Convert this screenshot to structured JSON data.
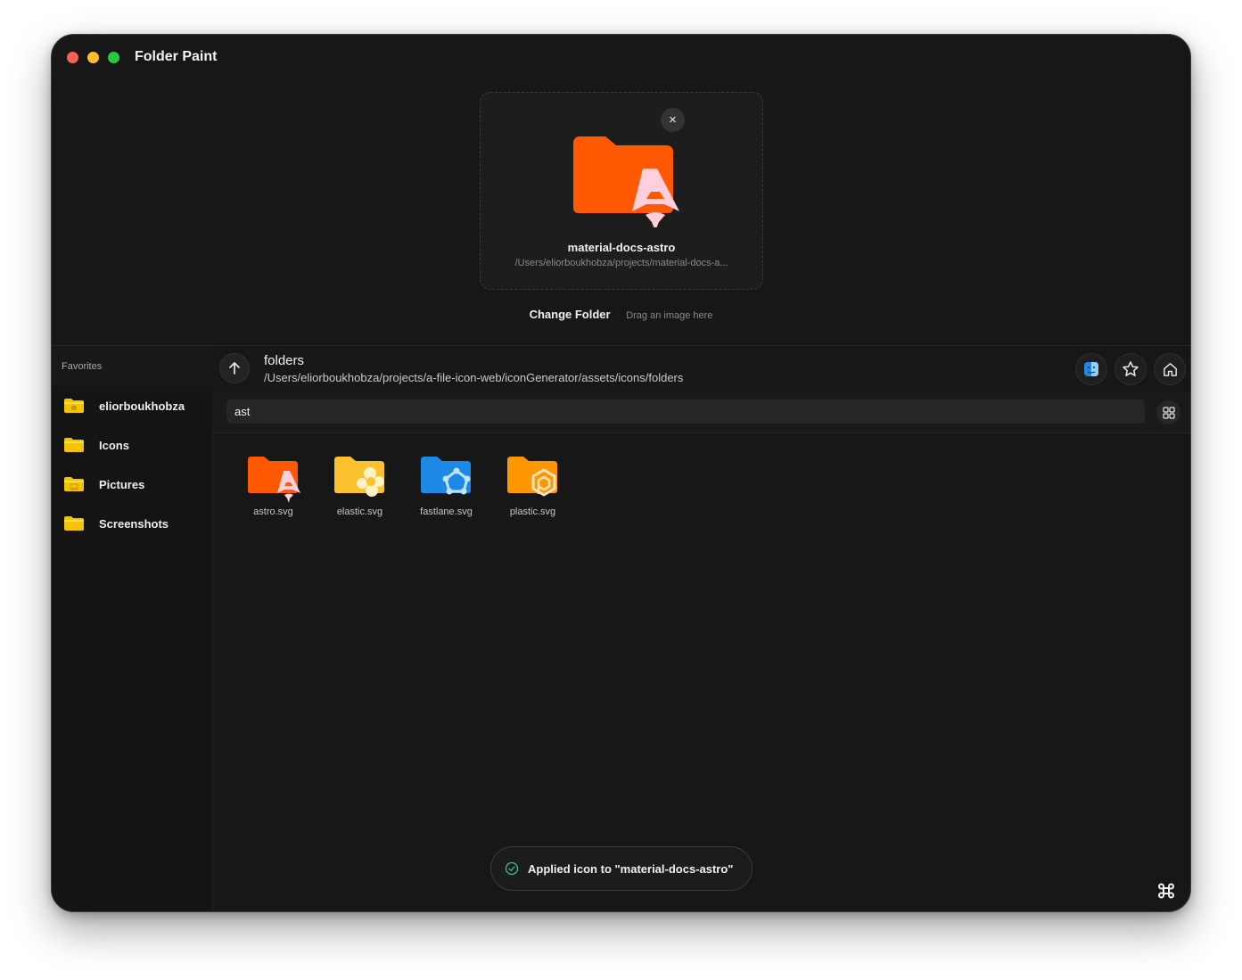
{
  "app": {
    "title": "Folder Paint"
  },
  "preview": {
    "folder_name": "material-docs-astro",
    "folder_path": "/Users/eliorboukhobza/projects/material-docs-a...",
    "close_icon": "×",
    "icon": "astro-folder-icon"
  },
  "actions": {
    "change_folder": "Change Folder",
    "drag_hint": "Drag an image here"
  },
  "sidebar": {
    "heading": "Favorites",
    "items": [
      {
        "label": "eliorboukhobza",
        "icon": "home-folder-icon"
      },
      {
        "label": "Icons",
        "icon": "folder-icon"
      },
      {
        "label": "Pictures",
        "icon": "pictures-folder-icon"
      },
      {
        "label": "Screenshots",
        "icon": "folder-icon"
      }
    ]
  },
  "browser": {
    "title": "folders",
    "path": "/Users/eliorboukhobza/projects/a-file-icon-web/iconGenerator/assets/icons/folders",
    "search_value": "ast",
    "files": [
      {
        "label": "astro.svg",
        "icon": "astro-folder-icon"
      },
      {
        "label": "elastic.svg",
        "icon": "elastic-folder-icon"
      },
      {
        "label": "fastlane.svg",
        "icon": "fastlane-folder-icon"
      },
      {
        "label": "plastic.svg",
        "icon": "plastic-folder-icon"
      }
    ]
  },
  "toast": {
    "message": "Applied icon to \"material-docs-astro\""
  },
  "colors": {
    "window_bg": "#171717",
    "astro_orange": "#ff5a03",
    "elastic_yellow": "#fbc02d",
    "fastlane_blue": "#1e88e5",
    "plastic_orange": "#ff9800",
    "favorite_folder": "#f5c400",
    "toast_check": "#3ec281"
  }
}
